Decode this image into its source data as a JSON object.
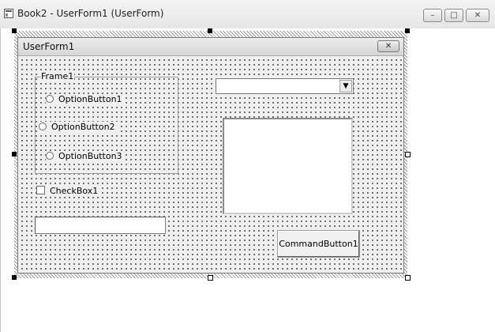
{
  "window": {
    "title": "Book2 - UserForm1 (UserForm)",
    "icon": "excel-sheet-icon",
    "controls": {
      "minimize": "–",
      "maximize": "□",
      "close": "✕"
    }
  },
  "userform": {
    "title": "UserForm1",
    "close_glyph": "✕",
    "frame": {
      "caption": "Frame1",
      "options": [
        "OptionButton1",
        "OptionButton2",
        "OptionButton3"
      ]
    },
    "checkbox": {
      "label": "CheckBox1",
      "checked": false
    },
    "textbox": {
      "value": ""
    },
    "combobox": {
      "value": "",
      "arrow": "▼"
    },
    "listbox": {
      "items": []
    },
    "command_button": {
      "label": "CommandButton1"
    }
  },
  "colors": {
    "form_bg": "#f0f0f0",
    "grid_dot": "#1a1a1a",
    "selection_hatch": "#9a9a9a"
  }
}
